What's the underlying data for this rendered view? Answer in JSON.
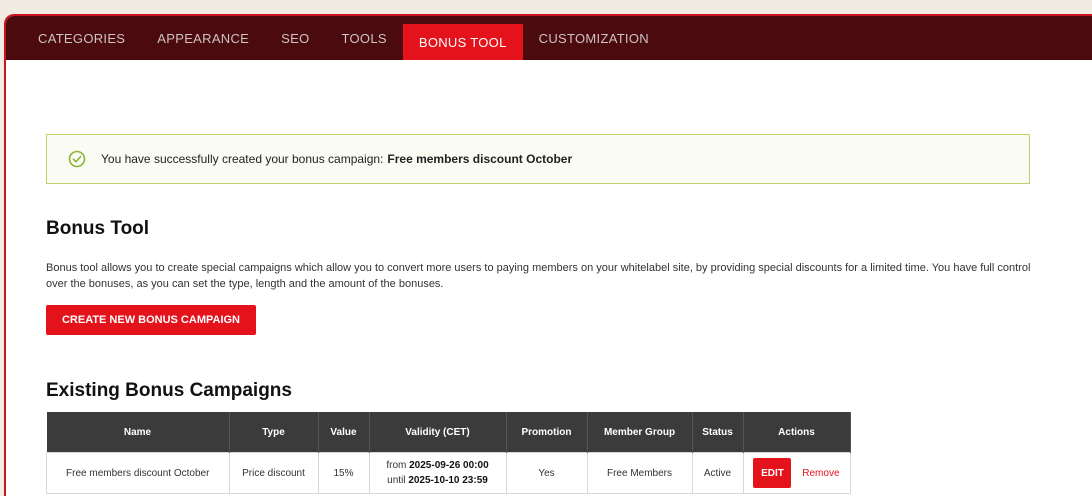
{
  "tabs": [
    {
      "label": "CATEGORIES"
    },
    {
      "label": "APPEARANCE"
    },
    {
      "label": "SEO"
    },
    {
      "label": "TOOLS"
    },
    {
      "label": "BONUS TOOL"
    },
    {
      "label": "CUSTOMIZATION"
    }
  ],
  "active_tab": "BONUS TOOL",
  "alert": {
    "icon": "check-circle-icon",
    "text": "You have successfully created your bonus campaign:",
    "campaign_name": "Free members discount October"
  },
  "bonus_tool": {
    "title": "Bonus Tool",
    "description": "Bonus tool allows you to create special campaigns which allow you to convert more users to paying members on your whitelabel site, by providing special discounts for a limited time. You have full control over the bonuses, as you can set the type, length and the amount of the bonuses.",
    "create_button": "CREATE NEW BONUS CAMPAIGN"
  },
  "existing": {
    "title": "Existing Bonus Campaigns",
    "columns": [
      "Name",
      "Type",
      "Value",
      "Validity (CET)",
      "Promotion",
      "Member Group",
      "Status",
      "Actions"
    ],
    "rows": [
      {
        "name": "Free members discount October",
        "type": "Price discount",
        "value": "15%",
        "validity_from_label": "from",
        "validity_from": "2025-09-26 00:00",
        "validity_until_label": "until",
        "validity_until": "2025-10-10 23:59",
        "promotion": "Yes",
        "member_group": "Free Members",
        "status": "Active",
        "edit_label": "EDIT",
        "remove_label": "Remove"
      }
    ]
  },
  "colors": {
    "tabbar": "#4a0a0e",
    "accent": "#e3121b",
    "success_border": "#b9d36c",
    "status_active": "#5ca13a",
    "table_header": "#3b3b3b"
  }
}
